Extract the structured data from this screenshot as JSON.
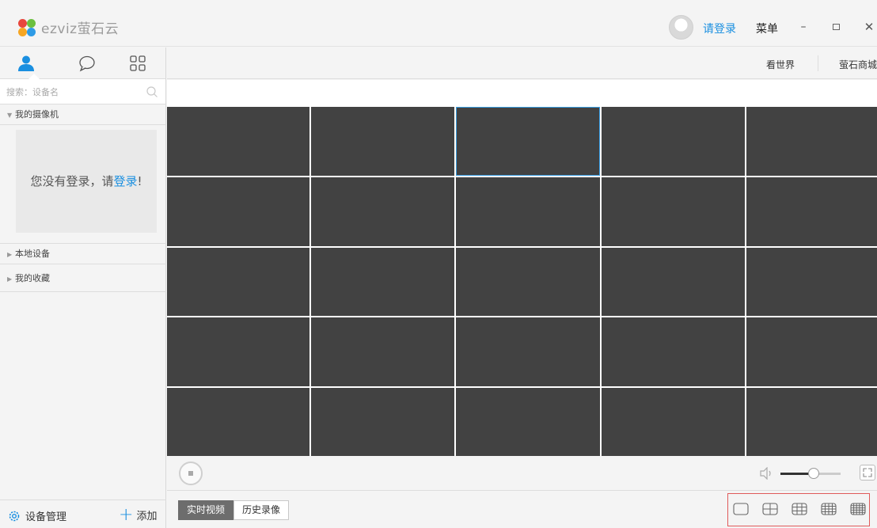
{
  "titlebar": {
    "logo_text": "ezviz萤石云",
    "login_link": "请登录",
    "menu_label": "菜单",
    "min_glyph": "–",
    "close_glyph": "✕"
  },
  "sidebar": {
    "tabs": [
      {
        "icon": "user-icon"
      },
      {
        "icon": "chat-icon"
      },
      {
        "icon": "apps-grid-icon"
      }
    ],
    "search": {
      "placeholder": "搜索：设备名"
    },
    "groups": {
      "my_cameras": "我的摄像机",
      "local_devices": "本地设备",
      "favorites": "我的收藏"
    },
    "login_message": {
      "prefix": "您没有登录，请",
      "link": "登录",
      "suffix": "!"
    },
    "bottom": {
      "device_manage": "设备管理",
      "add": "添加"
    }
  },
  "topnav": {
    "world": "看世界",
    "mall": "萤石商城"
  },
  "player": {
    "volume_level": 0.55,
    "selected_cell": 2,
    "modes": [
      {
        "label": "实时视频",
        "active": true
      },
      {
        "label": "历史录像",
        "active": false
      }
    ],
    "layouts": [
      "layout-1x1-icon",
      "layout-2x2-icon",
      "layout-3x3-icon",
      "layout-4x4-icon",
      "layout-5x5-icon"
    ]
  },
  "colors": {
    "accent": "#1a8fe0",
    "cell": "#424242",
    "selection": "#3a9ee4",
    "highlight_box": "#e05a5a"
  }
}
